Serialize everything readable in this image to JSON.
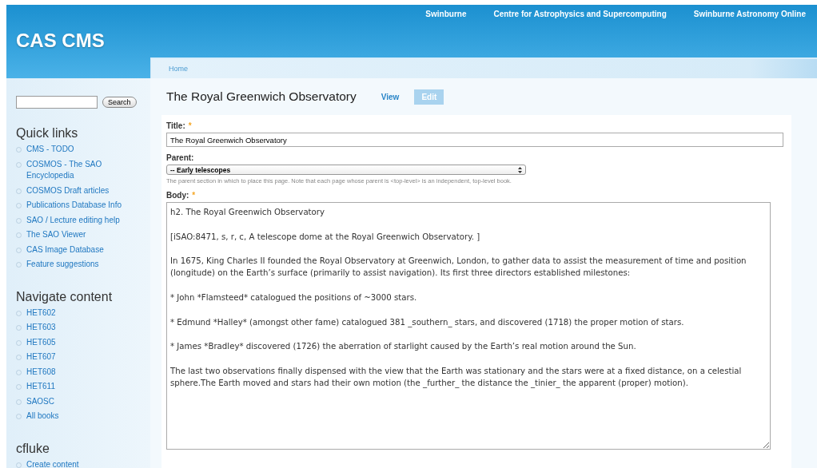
{
  "header": {
    "site_name": "CAS CMS",
    "links": [
      "Swinburne",
      "Centre for Astrophysics and Supercomputing",
      "Swinburne Astronomy Online"
    ]
  },
  "breadcrumb": [
    "Home"
  ],
  "sidebar": {
    "search": {
      "button": "Search"
    },
    "blocks": [
      {
        "title": "Quick links",
        "items": [
          "CMS - TODO",
          "COSMOS - The SAO Encyclopedia",
          "COSMOS Draft articles",
          "Publications Database Info",
          "SAO / Lecture editing help",
          "The SAO Viewer",
          "CAS Image Database",
          "Feature suggestions"
        ]
      },
      {
        "title": "Navigate content",
        "items": [
          "HET602",
          "HET603",
          "HET605",
          "HET607",
          "HET608",
          "HET611",
          "SAOSC",
          "All books"
        ]
      },
      {
        "title": "cfluke",
        "items": [
          "Create content"
        ]
      }
    ]
  },
  "page": {
    "title": "The Royal Greenwich Observatory",
    "tabs": [
      {
        "label": "View",
        "selected": false
      },
      {
        "label": "Edit",
        "selected": true
      }
    ],
    "form": {
      "title": {
        "label": "Title:",
        "required_mark": "*",
        "value": "The Royal Greenwich Observatory"
      },
      "parent": {
        "label": "Parent:",
        "value": "-- Early telescopes",
        "help": "The parent section in which to place this page. Note that each page whose parent is <top-level> is an independent, top-level book."
      },
      "body": {
        "label": "Body:",
        "required_mark": "*",
        "paragraphs": [
          "h2. The Royal Greenwich Observatory",
          "[iSAO:8471, s, r, c, A telescope dome at the Royal Greenwich Observatory. ]",
          "In 1675, King Charles II founded the Royal Observatory at Greenwich, London, to gather data to assist the measurement of time and position (longitude) on the Earth’s surface (primarily to assist navigation). Its first three directors established milestones:",
          "* John *Flamsteed* catalogued the positions of ~3000 stars.",
          "* Edmund *Halley* (amongst other fame) catalogued 381 _southern_ stars, and discovered (1718) the proper motion of stars.",
          "* James *Bradley* discovered (1726) the aberration of starlight caused by the Earth’s real motion around the Sun.",
          "The last two observations finally dispensed with the view that the Earth was stationary and the stars were at a fixed distance, on a celestial sphere.The Earth moved and stars had their own motion (the _further_ the distance the _tinier_ the apparent (proper) motion)."
        ]
      }
    }
  }
}
